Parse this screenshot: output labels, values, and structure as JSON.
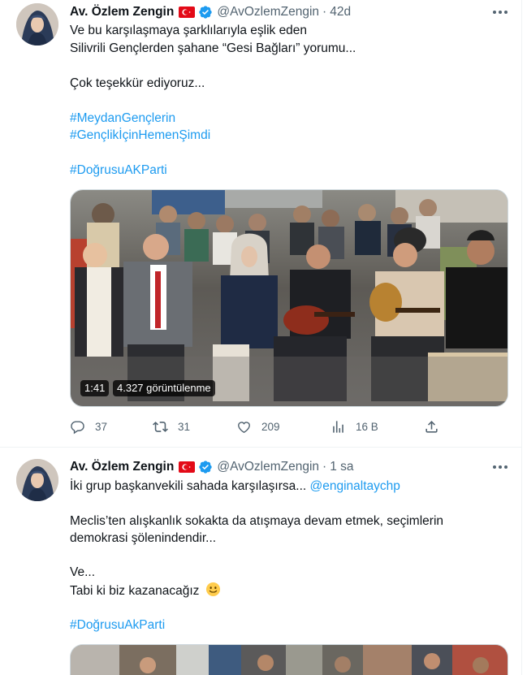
{
  "colors": {
    "text_primary": "#0f1419",
    "text_secondary": "#536471",
    "link": "#1d9bf0",
    "verified_badge": "#1d9bf0",
    "divider": "#eff3f4"
  },
  "tweets": [
    {
      "author": "Av. Özlem Zengin",
      "flag_icon": "turkey-flag-icon",
      "verified_icon": "verified-badge-icon",
      "handle": "@AvOzlemZengin",
      "separator": "·",
      "time": "42d",
      "more_icon": "more-horizontal-icon",
      "lines": [
        "Ve bu karşılaşmaya şarklılarıyla eşlik eden",
        "Silivrili Gençlerden şahane “Gesi Bağları” yorumu...",
        "Çok teşekkür ediyoruz...",
        "#MeydanGençlerin",
        "#GençlikİçinHemenŞimdi",
        "#DoğrusuAKParti"
      ],
      "video": {
        "duration": "1:41",
        "views": "4.327 görüntülenme"
      },
      "actions": {
        "replies": "37",
        "retweets": "31",
        "likes": "209",
        "views": "16 B",
        "reply_icon": "reply-icon",
        "retweet_icon": "retweet-icon",
        "like_icon": "heart-icon",
        "views_icon": "analytics-icon",
        "share_icon": "share-icon"
      }
    },
    {
      "author": "Av. Özlem Zengin",
      "flag_icon": "turkey-flag-icon",
      "verified_icon": "verified-badge-icon",
      "handle": "@AvOzlemZengin",
      "separator": "·",
      "time": "1 sa",
      "more_icon": "more-horizontal-icon",
      "line1_text": "İki grup başkanvekili sahada karşılaşırsa...",
      "mention": "@enginaltaychp",
      "lines": [
        "Meclis’ten alışkanlık sokakta da atışmaya devam etmek, seçimlerin",
        "demokrasi şölenindendir...",
        "Ve...",
        "Tabi ki biz kazanacağız",
        "#DoğrusuAkParti"
      ],
      "emoji": "🙂"
    }
  ]
}
